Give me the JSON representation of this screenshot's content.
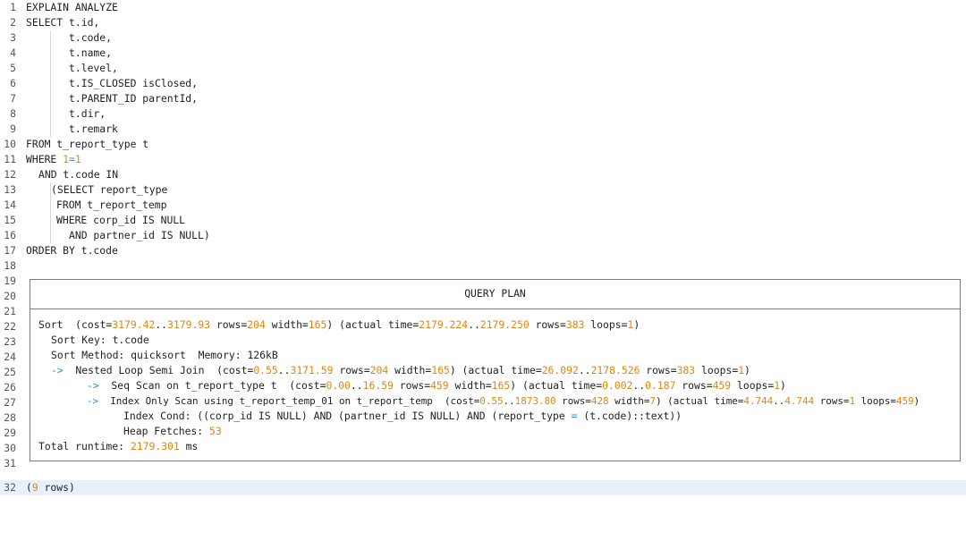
{
  "editor": {
    "line_numbers": [
      "1",
      "2",
      "3",
      "4",
      "5",
      "6",
      "7",
      "8",
      "9",
      "10",
      "11",
      "12",
      "13",
      "14",
      "15",
      "16",
      "17",
      "18",
      "19",
      "20",
      "21",
      "22",
      "23",
      "24",
      "25",
      "26",
      "27",
      "28",
      "29",
      "30",
      "31",
      "32"
    ],
    "sql": {
      "l1": "EXPLAIN ANALYZE",
      "l2": "SELECT t.id,",
      "l3": "t.code,",
      "l4": "t.name,",
      "l5": "t.level,",
      "l6": "t.IS_CLOSED isClosed,",
      "l7": "t.PARENT_ID parentId,",
      "l8": "t.dir,",
      "l9": "t.remark",
      "l10": "FROM t_report_type t",
      "l11_a": "WHERE ",
      "l11_n1": "1",
      "l11_op": "=",
      "l11_n2": "1",
      "l12": "AND t.code IN",
      "l13": "(SELECT report_type",
      "l14": "FROM t_report_temp",
      "l15": "WHERE corp_id IS NULL",
      "l16": "AND partner_id IS NULL)",
      "l17": "ORDER BY t.code"
    },
    "plan": {
      "header": "QUERY PLAN",
      "r22": {
        "a": "Sort  (cost=",
        "n1": "3179.42",
        "d1": "..",
        "n2": "3179.93",
        "b": " rows=",
        "n3": "204",
        "c": " width=",
        "n4": "165",
        "e": ") (actual time=",
        "n5": "2179.224",
        "d2": "..",
        "n6": "2179.250",
        "f": " rows=",
        "n7": "383",
        "g": " loops=",
        "n8": "1",
        "h": ")"
      },
      "r23": "Sort Key: t.code",
      "r24": "Sort Method: quicksort  Memory: 126kB",
      "r25": {
        "arrow": "->",
        "a": "  Nested Loop Semi Join  (cost=",
        "n1": "0.55",
        "d1": "..",
        "n2": "3171.59",
        "b": " rows=",
        "n3": "204",
        "c": " width=",
        "n4": "165",
        "e": ") (actual time=",
        "n5": "26.092",
        "d2": "..",
        "n6": "2178.526",
        "f": " rows=",
        "n7": "383",
        "g": " loops=",
        "n8": "1",
        "h": ")"
      },
      "r26": {
        "arrow": "->",
        "a": "  Seq Scan on t_report_type t  (cost=",
        "n1": "0.00",
        "d1": "..",
        "n2": "16.59",
        "b": " rows=",
        "n3": "459",
        "c": " width=",
        "n4": "165",
        "e": ") (actual time=",
        "n5": "0.002",
        "d2": "..",
        "n6": "0.187",
        "f": " rows=",
        "n7": "459",
        "g": " loops=",
        "n8": "1",
        "h": ")"
      },
      "r27": {
        "arrow": "->",
        "a": "  Index Only Scan using t_report_temp_01 on t_report_temp  (cost=",
        "n1": "0.55",
        "d1": "..",
        "n2": "1873.80",
        "b": " rows=",
        "n3": "428",
        "c": " width=",
        "n4": "7",
        "e": ") (actual time=",
        "n5": "4.744",
        "d2": "..",
        "n6": "4.744",
        "f": " rows=",
        "n7": "1",
        "g": " loops=",
        "n8": "459",
        "h": ")"
      },
      "r28": {
        "a": "Index Cond: ((corp_id IS NULL) AND (partner_id IS NULL) AND (report_type ",
        "op": "=",
        "b": " (t.code)::text))"
      },
      "r29": {
        "a": "Heap Fetches: ",
        "n": "53"
      },
      "r30": {
        "a": "Total runtime: ",
        "n": "2179.301",
        "b": " ms"
      }
    },
    "footer": {
      "open": "(",
      "n": "9",
      "rest": " rows)"
    }
  },
  "colors": {
    "number": "#e5840c",
    "operator": "#2a8fe0",
    "current_line": "#e8f0fb"
  }
}
